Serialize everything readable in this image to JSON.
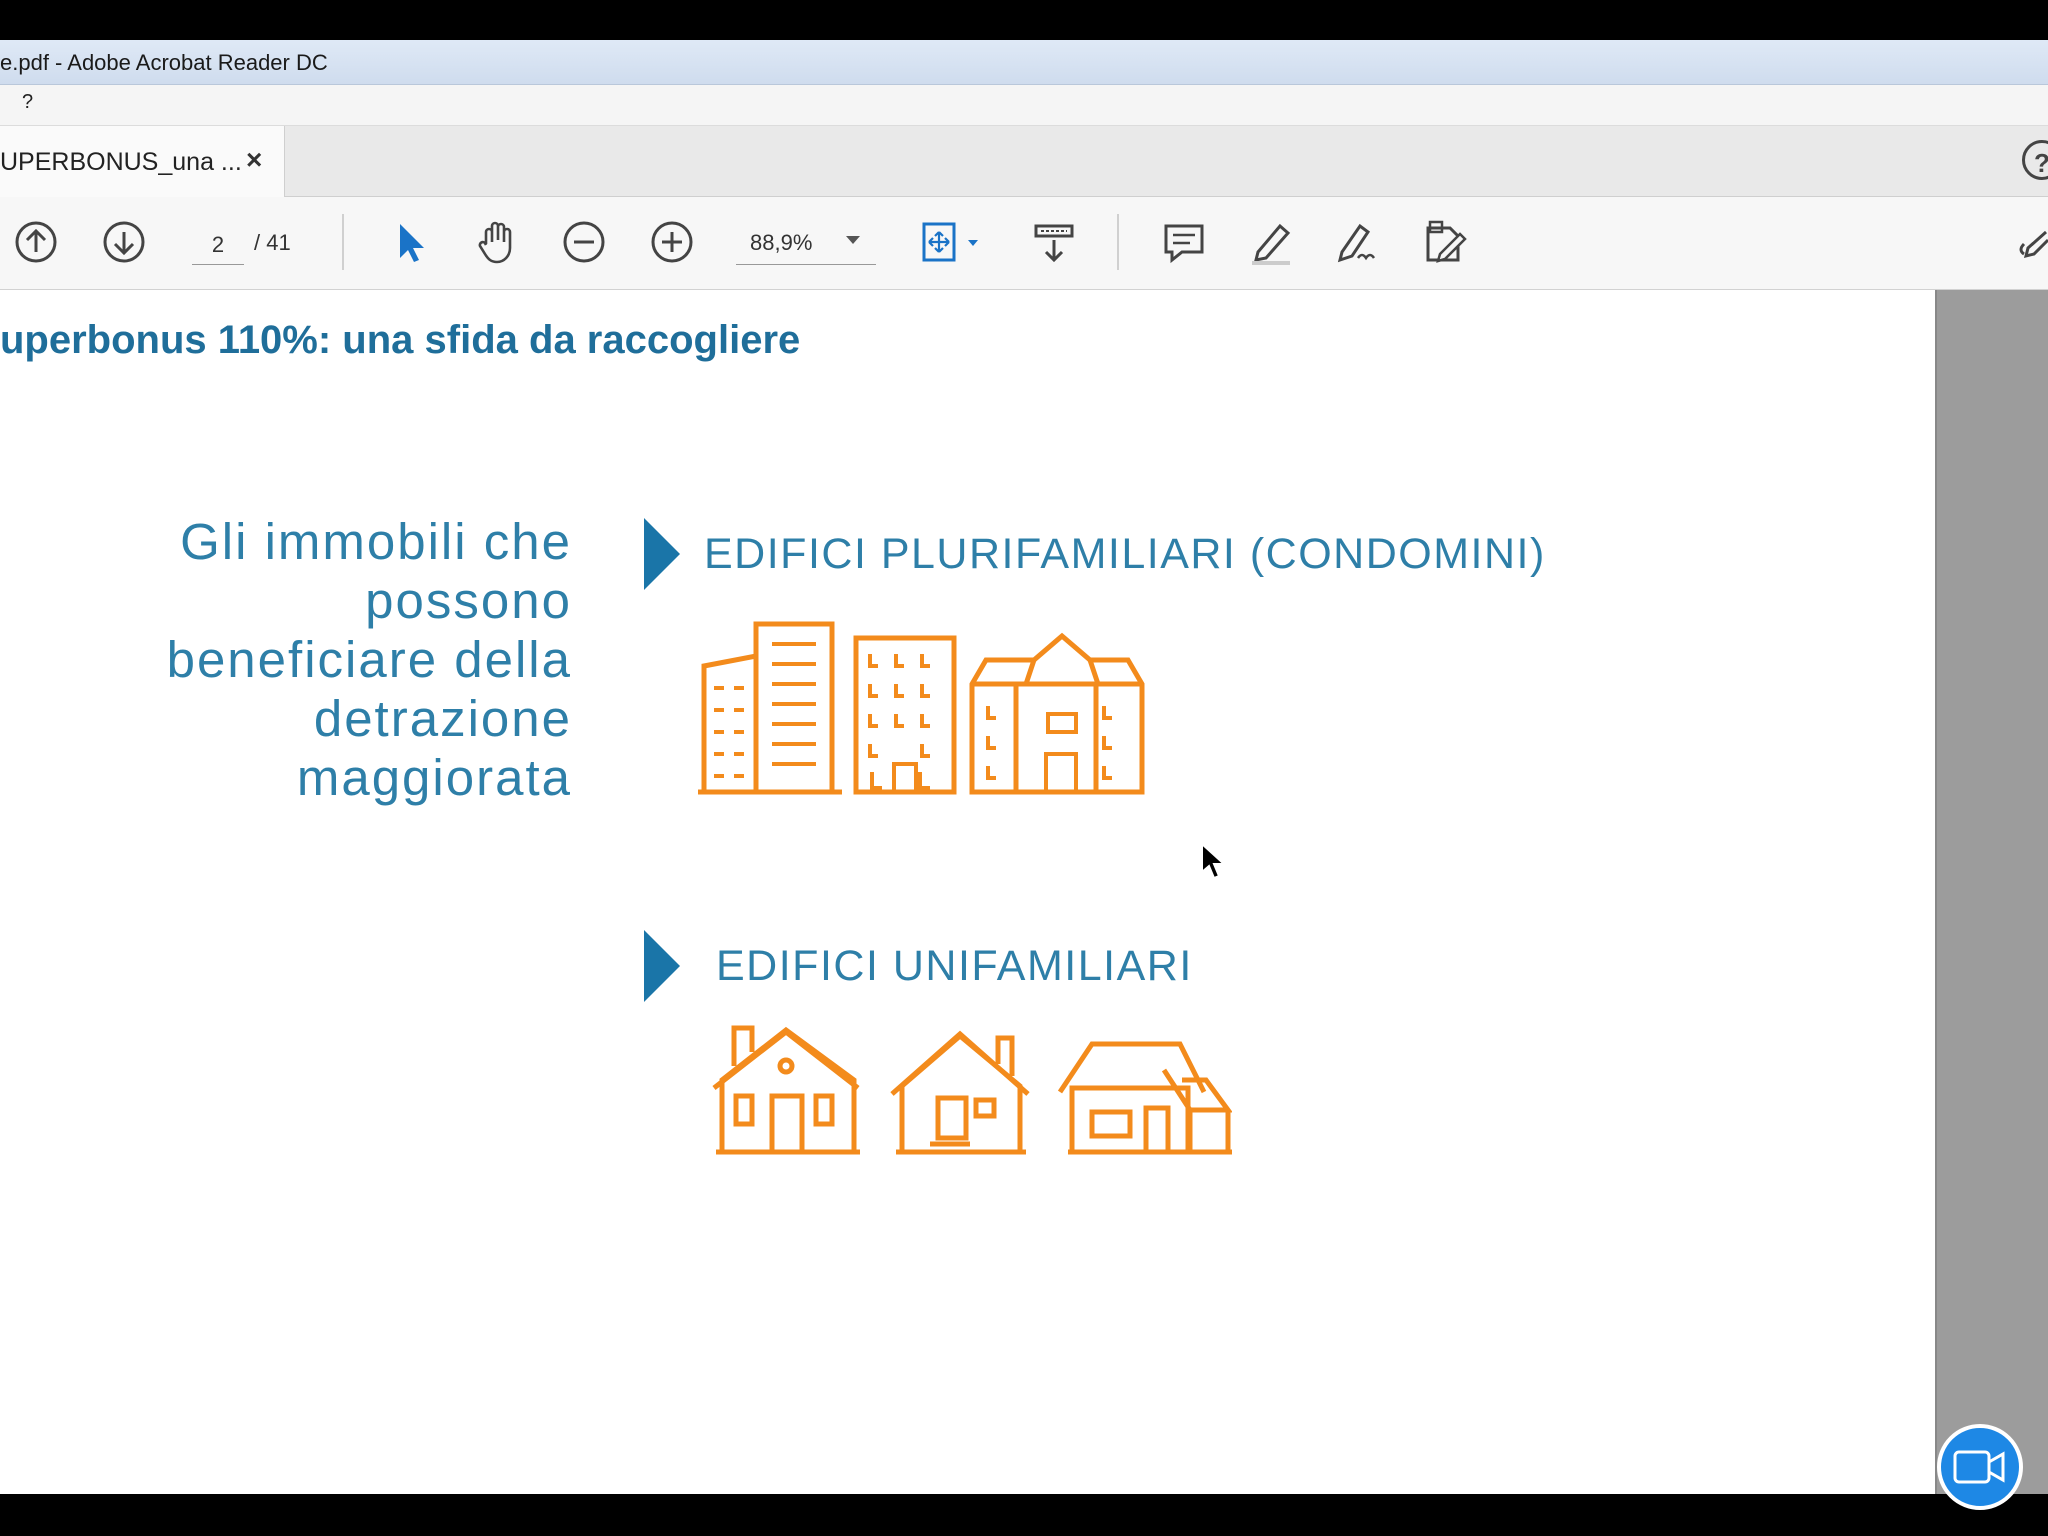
{
  "window": {
    "title": "e.pdf - Adobe Acrobat Reader DC"
  },
  "menubar": {
    "help": "?"
  },
  "tab": {
    "label": "UPERBONUS_una ...",
    "close": "×"
  },
  "help_button": {
    "label": "?"
  },
  "toolbar": {
    "page_current": "2",
    "page_total": "/ 41",
    "zoom": "88,9%",
    "icons": [
      "previous-page-icon",
      "next-page-icon",
      "select-icon",
      "hand-icon",
      "zoom-out-icon",
      "zoom-in-icon",
      "fit-page-icon",
      "scroll-mode-icon",
      "comment-icon",
      "highlight-icon",
      "sign-icon",
      "edit-pdf-icon",
      "share-icon"
    ]
  },
  "slide": {
    "title": "uperbonus 110%: una sfida da raccogliere",
    "intro_lines": [
      "Gli immobili che",
      "possono",
      "beneficiare della",
      "detrazione",
      "maggiorata"
    ],
    "section1": "EDIFICI PLURIFAMILIARI (CONDOMINI)",
    "section2": "EDIFICI UNIFAMILIARI"
  },
  "colors": {
    "accent_blue": "#1a75a8",
    "text_blue": "#2e7fa8",
    "icon_orange": "#f38b1c"
  }
}
